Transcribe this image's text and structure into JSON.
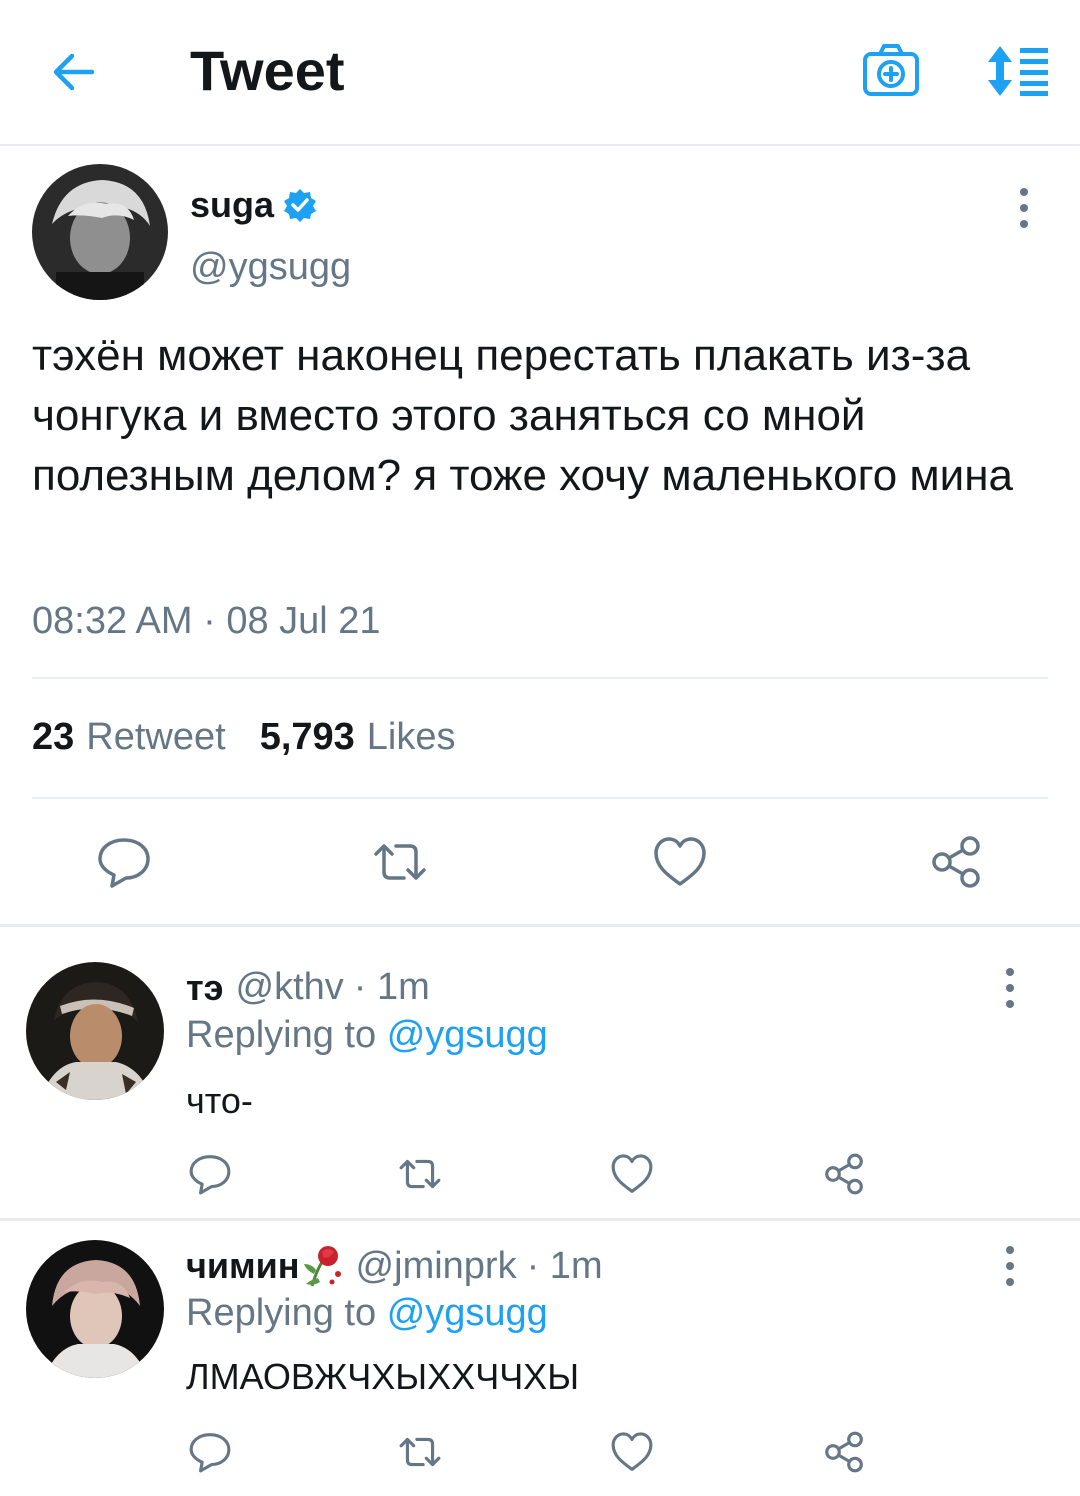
{
  "header": {
    "title": "Tweet"
  },
  "icons": {
    "back": "arrow-left-icon",
    "camera": "camera-plus-icon",
    "sort": "sort-list-icon",
    "more": "more-vertical-icon",
    "reply": "reply-icon",
    "retweet": "retweet-icon",
    "like": "heart-icon",
    "share": "share-icon",
    "verified": "verified-badge-icon",
    "rose": "wilted-rose-emoji"
  },
  "colors": {
    "accent": "#1da1f2",
    "text": "#14171a",
    "muted": "#657786",
    "divider": "#e6ecf0"
  },
  "tweet": {
    "name": "suga",
    "handle": "@ygsugg",
    "text": "тэхён может наконец перестать плакать из-за чонгука и вместо этого заняться со мной полезным делом? я тоже хочу маленького мина",
    "time": "08:32 AM · 08 Jul 21",
    "retweets": "23",
    "retweets_label": "Retweet",
    "likes": "5,793",
    "likes_label": "Likes"
  },
  "replies": [
    {
      "name": "тэ",
      "handle": "@kthv",
      "time": "· 1m",
      "replying_label": "Replying to",
      "replying_to": "@ygsugg",
      "text": "что-"
    },
    {
      "name": "чимин",
      "handle": "@jminprk",
      "time": "· 1m",
      "replying_label": "Replying to",
      "replying_to": "@ygsugg",
      "text": "ЛМАОВЖЧХЫХХЧЧХЫ"
    }
  ]
}
